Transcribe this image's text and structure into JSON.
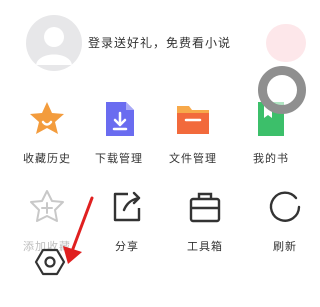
{
  "header": {
    "login_prompt": "登录送好礼，免费看小说"
  },
  "grid": {
    "row1": [
      {
        "label": "收藏历史",
        "icon": "star-icon"
      },
      {
        "label": "下载管理",
        "icon": "download-icon"
      },
      {
        "label": "文件管理",
        "icon": "folder-icon"
      },
      {
        "label": "我的书",
        "icon": "book-icon"
      }
    ],
    "row2": [
      {
        "label": "添加收藏",
        "icon": "add-bookmark-icon"
      },
      {
        "label": "分享",
        "icon": "share-icon"
      },
      {
        "label": "工具箱",
        "icon": "toolbox-icon"
      },
      {
        "label": "刷新",
        "icon": "refresh-icon"
      }
    ]
  },
  "bottom": {
    "settings_icon": "settings-icon"
  },
  "colors": {
    "accent_orange": "#f39c3d",
    "accent_purple": "#6a6cf0",
    "folder_orange": "#f26a3c",
    "arrow_red": "#e02020"
  }
}
